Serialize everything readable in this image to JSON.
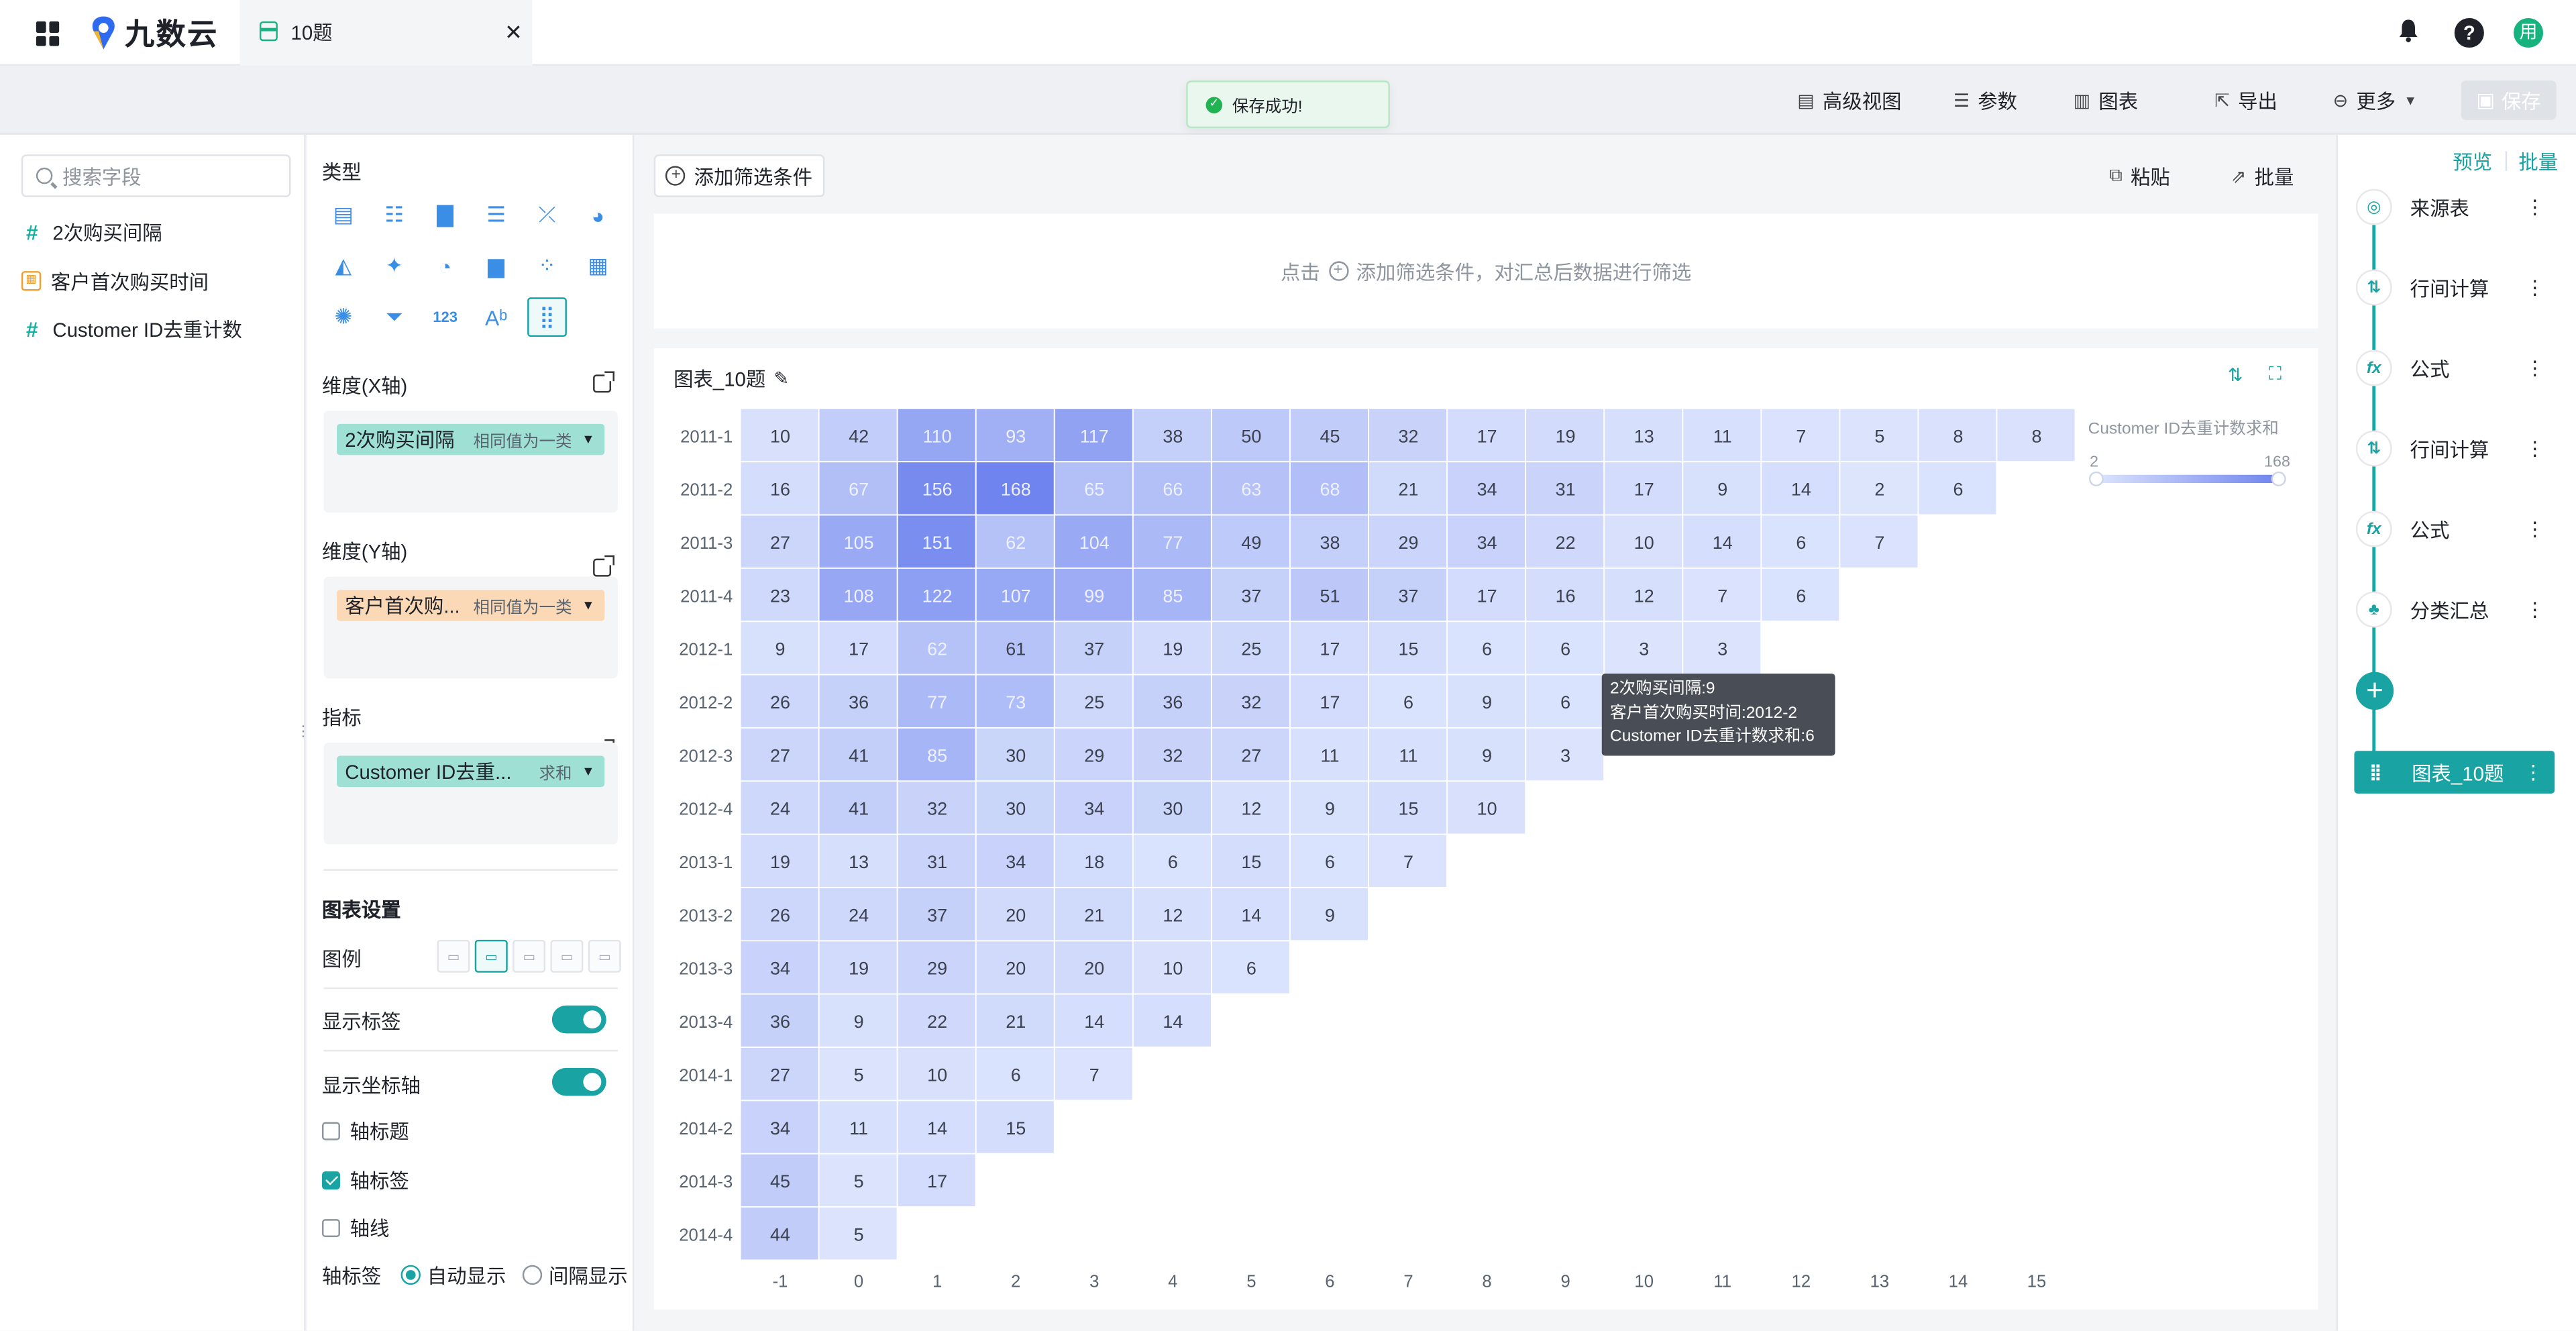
{
  "brand": {
    "name": "九数云"
  },
  "tab": {
    "title": "10题"
  },
  "toolbar": {
    "advanced_view": "高级视图",
    "params": "参数",
    "chart": "图表",
    "export": "导出",
    "more": "更多",
    "save": "保存"
  },
  "toast": {
    "message": "保存成功!"
  },
  "fields": {
    "search_placeholder": "搜索字段",
    "items": [
      {
        "label": "2次购买间隔",
        "type": "number"
      },
      {
        "label": "客户首次购买时间",
        "type": "date"
      },
      {
        "label": "Customer ID去重计数",
        "type": "number"
      }
    ]
  },
  "config": {
    "type_title": "类型",
    "x_title": "维度(X轴)",
    "x_field": "2次购买间隔",
    "x_field_note": "相同值为一类",
    "y_title": "维度(Y轴)",
    "y_field": "客户首次购...",
    "y_field_note": "相同值为一类",
    "metric_title": "指标",
    "metric_field": "Customer ID去重...",
    "metric_agg": "求和",
    "settings_title": "图表设置",
    "legend_label": "图例",
    "show_labels": "显示标签",
    "show_axis": "显示坐标轴",
    "axis_title": "轴标题",
    "axis_label": "轴标签",
    "axis_line": "轴线",
    "axis_label_mode": "轴标签",
    "auto_show": "自动显示",
    "interval_show": "间隔显示",
    "show_labels_on": true,
    "show_axis_on": true,
    "axis_title_checked": false,
    "axis_label_checked": true,
    "axis_line_checked": false
  },
  "filter": {
    "add_button": "添加筛选条件",
    "hint_prefix": "点击",
    "hint_suffix": "添加筛选条件，对汇总后数据进行筛选",
    "paste": "粘贴",
    "batch": "批量"
  },
  "chart_card": {
    "title": "图表_10题"
  },
  "tooltip": {
    "line1": "2次购买间隔:9",
    "line2": "客户首次购买时间:2012-2",
    "line3": "Customer ID去重计数求和:6"
  },
  "flow": {
    "preview": "预览",
    "batch": "批量",
    "nodes": [
      "来源表",
      "行间计算",
      "公式",
      "行间计算",
      "公式",
      "分类汇总"
    ],
    "active_node": "图表_10题"
  },
  "chart_data": {
    "type": "heatmap",
    "title": "",
    "x_categories": [
      "-1",
      "0",
      "1",
      "2",
      "3",
      "4",
      "5",
      "6",
      "7",
      "8",
      "9",
      "10",
      "11",
      "12",
      "13",
      "14",
      "15"
    ],
    "y_categories": [
      "2011-1",
      "2011-2",
      "2011-3",
      "2011-4",
      "2012-1",
      "2012-2",
      "2012-3",
      "2012-4",
      "2013-1",
      "2013-2",
      "2013-3",
      "2013-4",
      "2014-1",
      "2014-2",
      "2014-3",
      "2014-4"
    ],
    "values": [
      [
        10,
        42,
        110,
        93,
        117,
        38,
        50,
        45,
        32,
        17,
        19,
        13,
        11,
        7,
        5,
        8,
        8
      ],
      [
        16,
        67,
        156,
        168,
        65,
        66,
        63,
        68,
        21,
        34,
        31,
        17,
        9,
        14,
        2,
        6
      ],
      [
        27,
        105,
        151,
        62,
        104,
        77,
        49,
        38,
        29,
        34,
        22,
        10,
        14,
        6,
        7
      ],
      [
        23,
        108,
        122,
        107,
        99,
        85,
        37,
        51,
        37,
        17,
        16,
        12,
        7,
        6
      ],
      [
        9,
        17,
        62,
        61,
        37,
        19,
        25,
        17,
        15,
        6,
        6,
        3,
        3
      ],
      [
        26,
        36,
        77,
        73,
        25,
        36,
        32,
        17,
        6,
        9,
        6
      ],
      [
        27,
        41,
        85,
        30,
        29,
        32,
        27,
        11,
        11,
        9,
        3
      ],
      [
        24,
        41,
        32,
        30,
        34,
        30,
        12,
        9,
        15,
        10
      ],
      [
        19,
        13,
        31,
        34,
        18,
        6,
        15,
        6,
        7
      ],
      [
        26,
        24,
        37,
        20,
        21,
        12,
        14,
        9
      ],
      [
        34,
        19,
        29,
        20,
        20,
        10,
        6
      ],
      [
        36,
        9,
        22,
        21,
        14,
        14
      ],
      [
        27,
        5,
        10,
        6,
        7
      ],
      [
        34,
        11,
        14,
        15
      ],
      [
        45,
        5,
        17
      ],
      [
        44,
        5
      ]
    ],
    "legend": {
      "title": "Customer ID去重计数求和",
      "min": 2,
      "max": 168
    },
    "colors": {
      "low": "#dde5fd",
      "high": "#6f84ee",
      "label_dark": "#3c4150",
      "label_light": "#eef1ff"
    }
  }
}
